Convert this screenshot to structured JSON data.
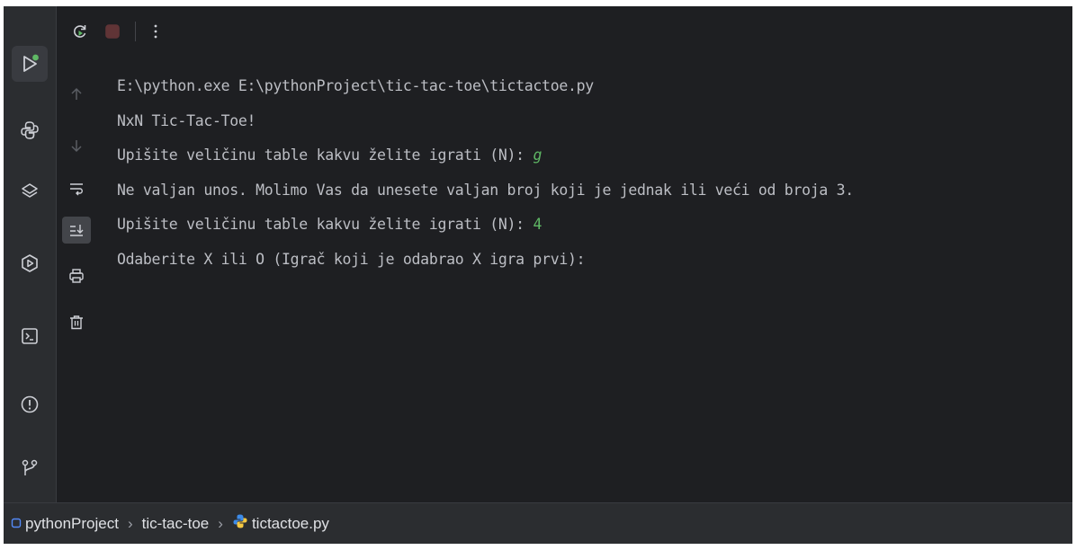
{
  "colors": {
    "background": "#1e1f22",
    "panel": "#2b2d30",
    "text": "#bcbec4",
    "user_input": "#5fb865",
    "stop_red": "#db5c5c",
    "run_green": "#5fb865"
  },
  "left_toolbar": {
    "items": [
      {
        "name": "run-tool",
        "icon": "run-icon",
        "active": true,
        "status_dot": "green"
      },
      {
        "name": "python-console-tool",
        "icon": "python-icon"
      },
      {
        "name": "python-packages-tool",
        "icon": "layers-icon"
      },
      {
        "name": "services-tool",
        "icon": "services-play-icon"
      },
      {
        "name": "terminal-tool",
        "icon": "terminal-icon"
      },
      {
        "name": "problems-tool",
        "icon": "problems-icon"
      },
      {
        "name": "git-tool",
        "icon": "git-branch-icon"
      }
    ]
  },
  "run_toolbar": {
    "buttons": [
      {
        "name": "rerun-button",
        "icon": "rerun-icon"
      },
      {
        "name": "stop-button",
        "icon": "stop-icon"
      },
      {
        "name": "more-options-button",
        "icon": "vertical-ellipsis-icon"
      }
    ]
  },
  "side_actions": [
    {
      "name": "scroll-up-button",
      "icon": "arrow-up-icon",
      "enabled": false
    },
    {
      "name": "scroll-down-button",
      "icon": "arrow-down-icon",
      "enabled": false
    },
    {
      "name": "soft-wrap-button",
      "icon": "soft-wrap-icon"
    },
    {
      "name": "scroll-to-end-button",
      "icon": "scroll-to-end-icon",
      "active": true
    },
    {
      "name": "print-button",
      "icon": "printer-icon"
    },
    {
      "name": "clear-all-button",
      "icon": "trash-icon"
    }
  ],
  "console": {
    "lines": [
      {
        "text": "E:\\python.exe E:\\pythonProject\\tic-tac-toe\\tictactoe.py"
      },
      {
        "text": "NxN Tic-Tac-Toe!"
      },
      {
        "text": "Upišite veličinu table kakvu želite igrati (N): ",
        "input": "g"
      },
      {
        "text": "Ne valjan unos. Molimo Vas da unesete valjan broj koji je jednak ili veći od broja 3."
      },
      {
        "text": "Upišite veličinu table kakvu želite igrati (N): ",
        "input": "4"
      },
      {
        "text": "Odaberite X ili O (Igrač koji je odabrao X igra prvi):"
      }
    ]
  },
  "breadcrumb": {
    "project": "pythonProject",
    "folder": "tic-tac-toe",
    "file": "tictactoe.py",
    "separator": "›",
    "project_icon": "module-square-icon",
    "file_icon": "python-file-icon"
  }
}
